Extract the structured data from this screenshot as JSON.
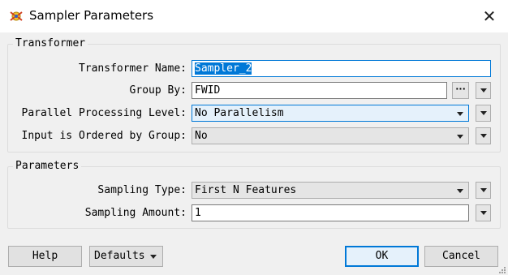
{
  "window": {
    "title": "Sampler Parameters",
    "close_glyph": "✕",
    "icon": "sampler-app-icon"
  },
  "transformer_group": {
    "legend": "Transformer",
    "name_label": "Transformer Name:",
    "name_value": "Sampler_2",
    "group_by_label": "Group By:",
    "group_by_value": "FWID",
    "group_by_more": "···",
    "parallel_label": "Parallel Processing Level:",
    "parallel_value": "No Parallelism",
    "ordered_label": "Input is Ordered by Group:",
    "ordered_value": "No"
  },
  "parameters_group": {
    "legend": "Parameters",
    "sampling_type_label": "Sampling Type:",
    "sampling_type_value": "First N Features",
    "sampling_amount_label": "Sampling Amount:",
    "sampling_amount_value": "1"
  },
  "footer": {
    "help_label": "Help",
    "defaults_label": "Defaults",
    "ok_label": "OK",
    "cancel_label": "Cancel"
  },
  "colors": {
    "accent": "#0078d7",
    "background": "#f0f0f0"
  }
}
